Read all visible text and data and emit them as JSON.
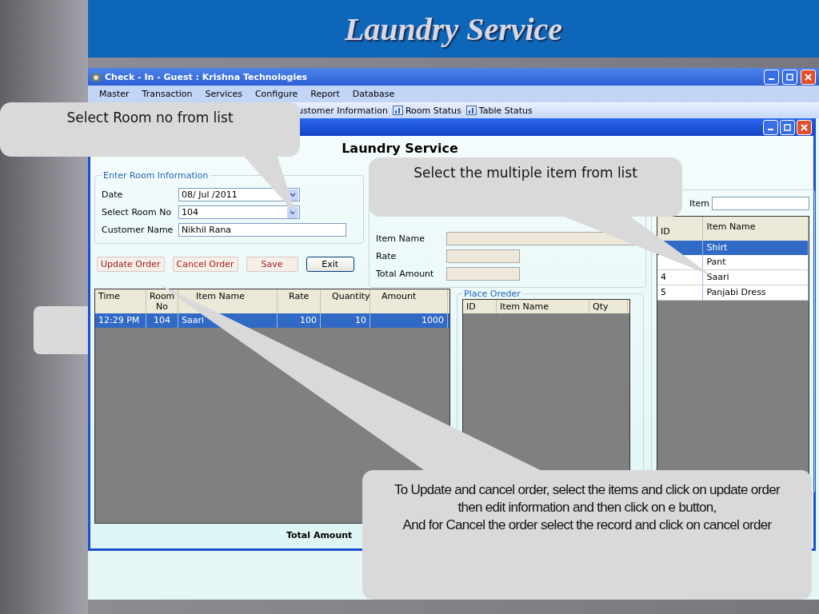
{
  "slide": {
    "title": "Laundry Service"
  },
  "window": {
    "title": "Check - In - Guest : Krishna Technologies"
  },
  "menu": [
    "Master",
    "Transaction",
    "Services",
    "Configure",
    "Report",
    "Database"
  ],
  "toolbar": [
    {
      "label": "ustomer Information",
      "kind": "text"
    },
    {
      "label": "Room Status",
      "kind": "icon-text"
    },
    {
      "label": "Table Status",
      "kind": "icon-text"
    }
  ],
  "form": {
    "heading": "Laundry Service",
    "room_info": {
      "legend": "Enter Room Information",
      "fields": [
        {
          "label": "Date",
          "value": "08/ Jul /2011",
          "kind": "dropdown"
        },
        {
          "label": "Select Room No",
          "value": "104",
          "kind": "dropdown"
        },
        {
          "label": "Customer Name",
          "value": "Nikhil Rana",
          "kind": "text"
        }
      ]
    },
    "buttons": [
      {
        "label": "Update Order",
        "kind": "action"
      },
      {
        "label": "Cancel Order",
        "kind": "action"
      },
      {
        "label": "Save",
        "kind": "action"
      },
      {
        "label": "Exit",
        "kind": "default"
      }
    ],
    "item_fields": [
      {
        "label": "Item Name",
        "kind": "wide"
      },
      {
        "label": "Rate",
        "kind": "short"
      },
      {
        "label": "Total Amount",
        "kind": "short"
      }
    ],
    "orders": {
      "columns": [
        "Time",
        "Room No",
        "Item Name",
        "Rate",
        "Quantity",
        "Amount"
      ],
      "rows": [
        {
          "cells": [
            "12:29 PM",
            "104",
            "Saari",
            "100",
            "10",
            "1000"
          ],
          "selected": true
        }
      ]
    },
    "total_label": "Total Amount",
    "place_order": {
      "legend": "Place Oreder",
      "columns": [
        "ID",
        "Item Name",
        "Qty"
      ]
    },
    "item_list": {
      "search_label": "Item",
      "columns": [
        "ID",
        "Item Name"
      ],
      "rows": [
        {
          "name": "Shirt",
          "selected": true
        },
        {
          "name": "Pant",
          "selected": false
        },
        {
          "id": "4",
          "name": "Saari",
          "selected": false
        },
        {
          "id": "5",
          "name": "Panjabi Dress",
          "selected": false
        }
      ]
    }
  },
  "callouts": [
    {
      "kind": "room",
      "paragraphs": [
        "Select Room no from list"
      ]
    },
    {
      "kind": "items",
      "paragraphs": [
        "Select the multiple item from list"
      ]
    },
    {
      "kind": "update",
      "paragraphs": [
        "To Update and cancel order, select the items and click on update order then edit information and then click on e button,",
        "And for Cancel the order select the record and click on cancel order"
      ]
    }
  ]
}
